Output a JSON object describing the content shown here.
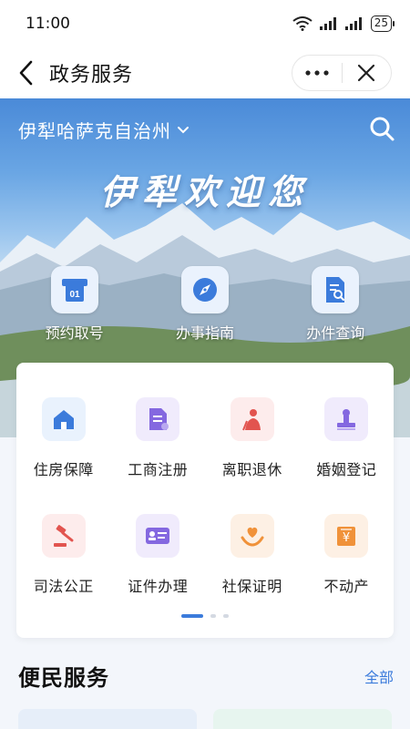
{
  "status_bar": {
    "time": "11:00",
    "battery": "25"
  },
  "nav": {
    "title": "政务服务",
    "back_icon": "chevron-left-icon",
    "more_icon": "more-dots-icon",
    "close_icon": "close-icon"
  },
  "hero": {
    "region": "伊犁哈萨克自治州",
    "welcome": "伊犁欢迎您",
    "quick_actions": [
      {
        "label": "预约取号",
        "icon": "ticket-number-icon",
        "badge": "01"
      },
      {
        "label": "办事指南",
        "icon": "compass-icon"
      },
      {
        "label": "办件查询",
        "icon": "document-search-icon"
      }
    ]
  },
  "services": [
    {
      "label": "住房保障",
      "icon": "house-icon",
      "color": "#3b7bdb",
      "bg": "#e9f2fd"
    },
    {
      "label": "工商注册",
      "icon": "document-icon",
      "color": "#8468e0",
      "bg": "#f0ebfc"
    },
    {
      "label": "离职退休",
      "icon": "retiree-icon",
      "color": "#e2544f",
      "bg": "#fdecec"
    },
    {
      "label": "婚姻登记",
      "icon": "stamp-icon",
      "color": "#8468e0",
      "bg": "#f0ebfc"
    },
    {
      "label": "司法公正",
      "icon": "gavel-icon",
      "color": "#e2544f",
      "bg": "#fdecec"
    },
    {
      "label": "证件办理",
      "icon": "id-card-icon",
      "color": "#8468e0",
      "bg": "#f0ebfc"
    },
    {
      "label": "社保证明",
      "icon": "heart-hand-icon",
      "color": "#f0923a",
      "bg": "#fdf0e4"
    },
    {
      "label": "不动产",
      "icon": "property-certificate-icon",
      "color": "#f0923a",
      "bg": "#fdf0e4"
    }
  ],
  "pagination": {
    "current_page": 1,
    "total_pages": 3
  },
  "convenience": {
    "title": "便民服务",
    "all_link": "全部"
  }
}
